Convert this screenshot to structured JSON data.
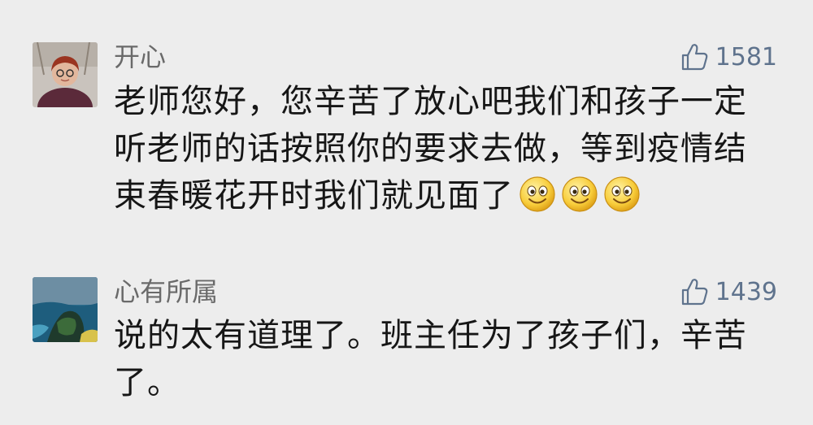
{
  "comments": [
    {
      "username": "开心",
      "likes": "1581",
      "lines": [
        "老师您好，您辛苦了放心吧我们和孩子一定",
        "听老师的话按照你的要求去做，等到疫情结",
        "束春暖花开时我们就见面了"
      ],
      "emojis": [
        "smile-emoji",
        "smile-emoji",
        "smile-emoji"
      ],
      "avatar_icon": "user-photo-avatar"
    },
    {
      "username": "心有所属",
      "likes": "1439",
      "lines": [
        "说的太有道理了。班主任为了孩子们，辛苦",
        "了。"
      ],
      "avatar_icon": "landscape-photo-avatar"
    }
  ],
  "icons": {
    "like": "thumbs-up-icon"
  },
  "colors": {
    "background": "#ededed",
    "username": "#6a6a6a",
    "like": "#5f738d",
    "text": "#161616"
  }
}
